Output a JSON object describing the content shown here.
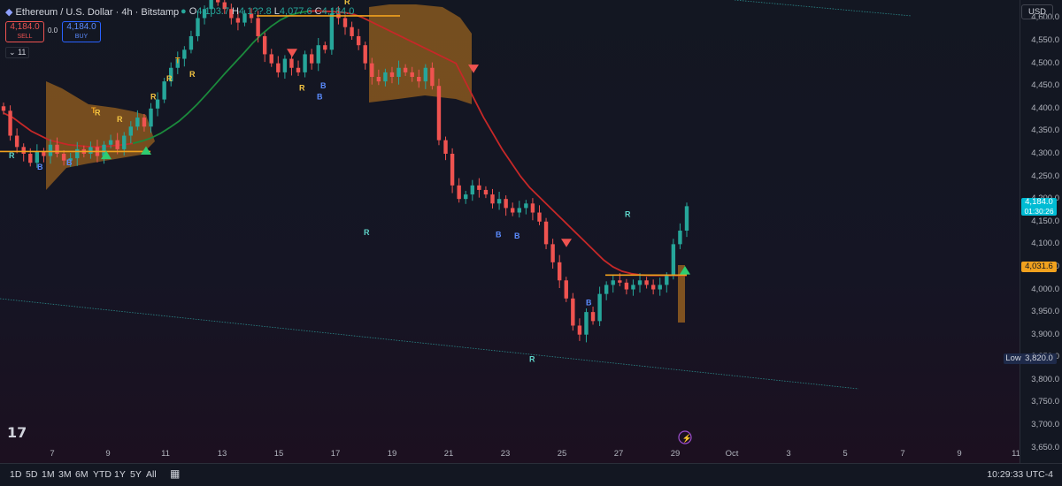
{
  "header": {
    "symbol": "Ethereum / U.S. Dollar · 4h · Bitstamp",
    "ohlc": {
      "o_label": "O",
      "o_value": "4,103.7",
      "h_label": "H",
      "h_value": "4,1??.8",
      "l_label": "L",
      "l_value": "4,077.6",
      "c_label": "C",
      "c_value": "4,184.0"
    },
    "sell_price": "4,184.0",
    "sell_label": "SELL",
    "spread": "0.0",
    "buy_price": "4,184.0",
    "buy_label": "BUY",
    "indicator_count": "11"
  },
  "colors": {
    "up": "#26a69a",
    "down": "#ef5350",
    "background": "#131722",
    "band": "#c77c1e",
    "ma_down": "#c62828",
    "ma_up": "#1b8a3c",
    "level": "#f0a11e"
  },
  "axis": {
    "currency": "USD",
    "price_ticks": [
      "4,600.0",
      "4,550.0",
      "4,500.0",
      "4,450.0",
      "4,400.0",
      "4,350.0",
      "4,300.0",
      "4,250.0",
      "4,200.0",
      "4,150.0",
      "4,100.0",
      "4,050.0",
      "4,000.0",
      "3,950.0",
      "3,900.0",
      "3,850.0",
      "3,800.0",
      "3,750.0",
      "3,700.0",
      "3,650.0"
    ],
    "last_price": "4,184.0",
    "countdown": "01:30:26",
    "level_price": "4,031.6",
    "low_label": "Low",
    "low_price": "3,820.0"
  },
  "date_ticks": [
    "7",
    "9",
    "11",
    "13",
    "15",
    "17",
    "19",
    "21",
    "23",
    "25",
    "27",
    "29",
    "Oct",
    "3",
    "5",
    "7",
    "9",
    "11"
  ],
  "timeframes": [
    "1D",
    "5D",
    "1M",
    "3M",
    "6M",
    "YTD",
    "1Y",
    "5Y",
    "All"
  ],
  "clock": "10:29:33 UTC-4",
  "chart_data": {
    "type": "candlestick",
    "title": "Ethereum / U.S. Dollar · 4h · Bitstamp",
    "x_ticks": [
      "7",
      "9",
      "11",
      "13",
      "15",
      "17",
      "19",
      "21",
      "23",
      "25",
      "27",
      "29",
      "Oct",
      "3",
      "5",
      "7",
      "9",
      "11"
    ],
    "ylim": [
      3620,
      4640
    ],
    "closes": [
      4395,
      4340,
      4315,
      4300,
      4280,
      4305,
      4295,
      4320,
      4300,
      4285,
      4290,
      4310,
      4300,
      4315,
      4295,
      4320,
      4330,
      4310,
      4340,
      4360,
      4380,
      4360,
      4400,
      4420,
      4460,
      4490,
      4510,
      4530,
      4560,
      4600,
      4620,
      4640,
      4635,
      4620,
      4600,
      4590,
      4610,
      4600,
      4560,
      4520,
      4500,
      4480,
      4510,
      4490,
      4480,
      4520,
      4500,
      4540,
      4530,
      4610,
      4600,
      4580,
      4560,
      4540,
      4500,
      4470,
      4460,
      4480,
      4470,
      4490,
      4480,
      4470,
      4460,
      4490,
      4450,
      4330,
      4300,
      4230,
      4200,
      4210,
      4230,
      4220,
      4210,
      4190,
      4200,
      4180,
      4170,
      4180,
      4190,
      4170,
      4150,
      4100,
      4060,
      4020,
      3980,
      3920,
      3900,
      3950,
      3930,
      3990,
      4010,
      4020,
      4015,
      4000,
      4010,
      4020,
      4010,
      4000,
      4010,
      4030,
      4100,
      4130,
      4184
    ],
    "ma_values": [
      4390,
      4380,
      4365,
      4350,
      4340,
      4330,
      4325,
      4320,
      4318,
      4316,
      4315,
      4316,
      4318,
      4320,
      4323,
      4328,
      4335,
      4345,
      4358,
      4372,
      4390,
      4410,
      4432,
      4455,
      4478,
      4500,
      4522,
      4545,
      4565,
      4582,
      4596,
      4606,
      4612,
      4615,
      4616,
      4615,
      4614,
      4612,
      4608,
      4600,
      4590,
      4580,
      4570,
      4560,
      4550,
      4540,
      4530,
      4520,
      4510,
      4500,
      4460,
      4420,
      4380,
      4345,
      4310,
      4280,
      4250,
      4225,
      4205,
      4185,
      4165,
      4145,
      4125,
      4105,
      4085,
      4065,
      4050,
      4040,
      4035,
      4032,
      4031,
      4031,
      4031,
      4031,
      4031
    ],
    "level": 4031.6,
    "low": 3820,
    "last": 4184,
    "signal_labels": [
      {
        "t": "R",
        "price": 4290
      },
      {
        "t": "B",
        "price": 4265
      },
      {
        "t": "B",
        "price": 4275
      },
      {
        "t": "T",
        "price": 4390
      },
      {
        "t": "R",
        "price": 4370
      },
      {
        "t": "R",
        "price": 4385
      },
      {
        "t": "R",
        "price": 4420
      },
      {
        "t": "T",
        "price": 4500
      },
      {
        "t": "R",
        "price": 4460
      },
      {
        "t": "R",
        "price": 4470
      },
      {
        "t": "R",
        "price": 4440
      },
      {
        "t": "B",
        "price": 4420
      },
      {
        "t": "B",
        "price": 4445
      },
      {
        "t": "R",
        "price": 4630
      },
      {
        "t": "R",
        "price": 4120
      },
      {
        "t": "B",
        "price": 4115
      },
      {
        "t": "B",
        "price": 4112
      },
      {
        "t": "R",
        "price": 3840
      },
      {
        "t": "B",
        "price": 3965
      },
      {
        "t": "R",
        "price": 4160
      }
    ]
  }
}
